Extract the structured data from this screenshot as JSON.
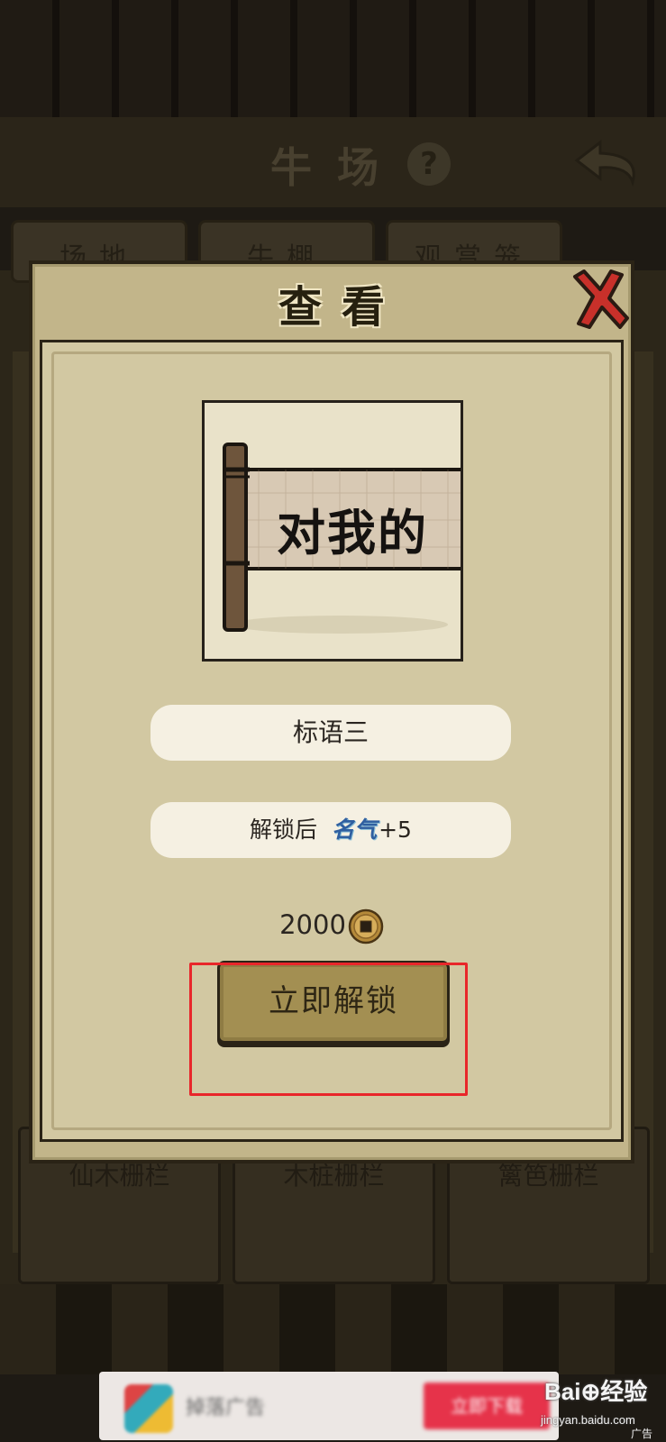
{
  "background": {
    "title": "牛场",
    "tabs": [
      "场地",
      "牛棚",
      "观赏笼"
    ],
    "cards": [
      "仙木栅栏",
      "木桩栅栏",
      "篱笆栅栏"
    ]
  },
  "modal": {
    "title": "查看",
    "item_name": "标语三",
    "banner_text": "对我的",
    "bonus_prefix": "解锁后",
    "bonus_stat": "名气",
    "bonus_value": "+5",
    "price": "2000",
    "unlock_label": "立即解锁"
  },
  "ad": {
    "title_text": "掉落广告",
    "cta_text": "立即下载",
    "label": "广告"
  },
  "watermark": {
    "brand": "Bai⊕经验",
    "site": "jingyan.baidu.com"
  },
  "colors": {
    "panel": "#c2b58a",
    "inner_panel": "#d2c8a2",
    "button": "#a38f52",
    "highlight": "#e8262a",
    "close_icon": "#c8302a",
    "stat_text": "#2f5fa0"
  },
  "icons": {
    "close": "close-x-icon",
    "currency": "copper-coin-icon",
    "help": "question-icon",
    "back": "back-arrow-icon"
  }
}
